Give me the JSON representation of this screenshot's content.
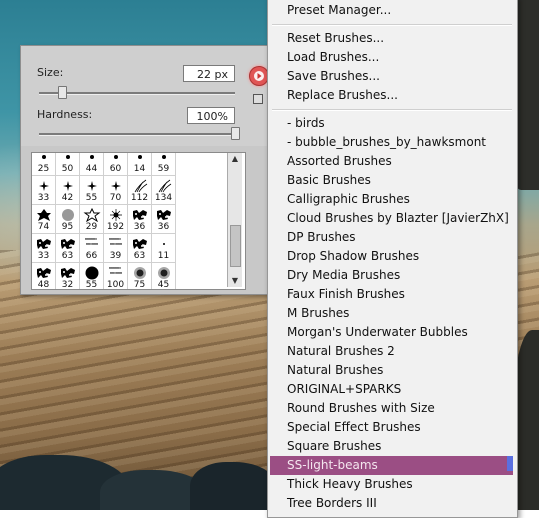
{
  "brush_panel": {
    "size_label": "Size:",
    "size_value": "22 px",
    "size_level": 0.11,
    "hardness_label": "Hardness:",
    "hardness_value": "100%",
    "hardness_level": 1.0,
    "flyout_icon": "right-arrow-circle-icon",
    "new_preset_icon": "new-preset-icon",
    "presets": [
      {
        "n": "25",
        "g": "dot"
      },
      {
        "n": "50",
        "g": "dot"
      },
      {
        "n": "44",
        "g": "dot"
      },
      {
        "n": "60",
        "g": "dot"
      },
      {
        "n": "14",
        "g": "dot"
      },
      {
        "n": "59",
        "g": "dot"
      },
      {
        "n": "33",
        "g": "star"
      },
      {
        "n": "42",
        "g": "star"
      },
      {
        "n": "55",
        "g": "star"
      },
      {
        "n": "70",
        "g": "star"
      },
      {
        "n": "112",
        "g": "grass"
      },
      {
        "n": "134",
        "g": "grass"
      },
      {
        "n": "74",
        "g": "leaf"
      },
      {
        "n": "95",
        "g": "leafsoft"
      },
      {
        "n": "29",
        "g": "starline"
      },
      {
        "n": "192",
        "g": "splat"
      },
      {
        "n": "36",
        "g": "scatter"
      },
      {
        "n": "36",
        "g": "scatter"
      },
      {
        "n": "33",
        "g": "scatter"
      },
      {
        "n": "63",
        "g": "scatter"
      },
      {
        "n": "66",
        "g": "speckle"
      },
      {
        "n": "39",
        "g": "speckle"
      },
      {
        "n": "63",
        "g": "scatter"
      },
      {
        "n": "11",
        "g": "tiny"
      },
      {
        "n": "48",
        "g": "scatter"
      },
      {
        "n": "32",
        "g": "scatter"
      },
      {
        "n": "55",
        "g": "bigdot"
      },
      {
        "n": "100",
        "g": "speckle"
      },
      {
        "n": "75",
        "g": "soft"
      },
      {
        "n": "45",
        "g": "soft"
      }
    ],
    "scroll_up_icon": "scroll-up-arrow-icon",
    "scroll_down_icon": "scroll-down-arrow-icon"
  },
  "menu": {
    "top_items": [
      "Preset Manager..."
    ],
    "file_items": [
      "Reset Brushes...",
      "Load Brushes...",
      "Save Brushes...",
      "Replace Brushes..."
    ],
    "library_items": [
      "- birds",
      "- bubble_brushes_by_hawksmont",
      "Assorted Brushes",
      "Basic Brushes",
      "Calligraphic Brushes",
      "Cloud Brushes by Blazter [JavierZhX]",
      "DP Brushes",
      "Drop Shadow Brushes",
      "Dry Media Brushes",
      "Faux Finish Brushes",
      "M Brushes",
      "Morgan's Underwater Bubbles",
      "Natural Brushes 2",
      "Natural Brushes",
      "ORIGINAL+SPARKS",
      "Round Brushes with Size",
      "Special Effect Brushes",
      "Square Brushes",
      "SS-light-beams",
      "Thick Heavy Brushes",
      "Tree Borders III"
    ],
    "highlighted_index": 18,
    "highlight_color": "#9b4e84"
  }
}
